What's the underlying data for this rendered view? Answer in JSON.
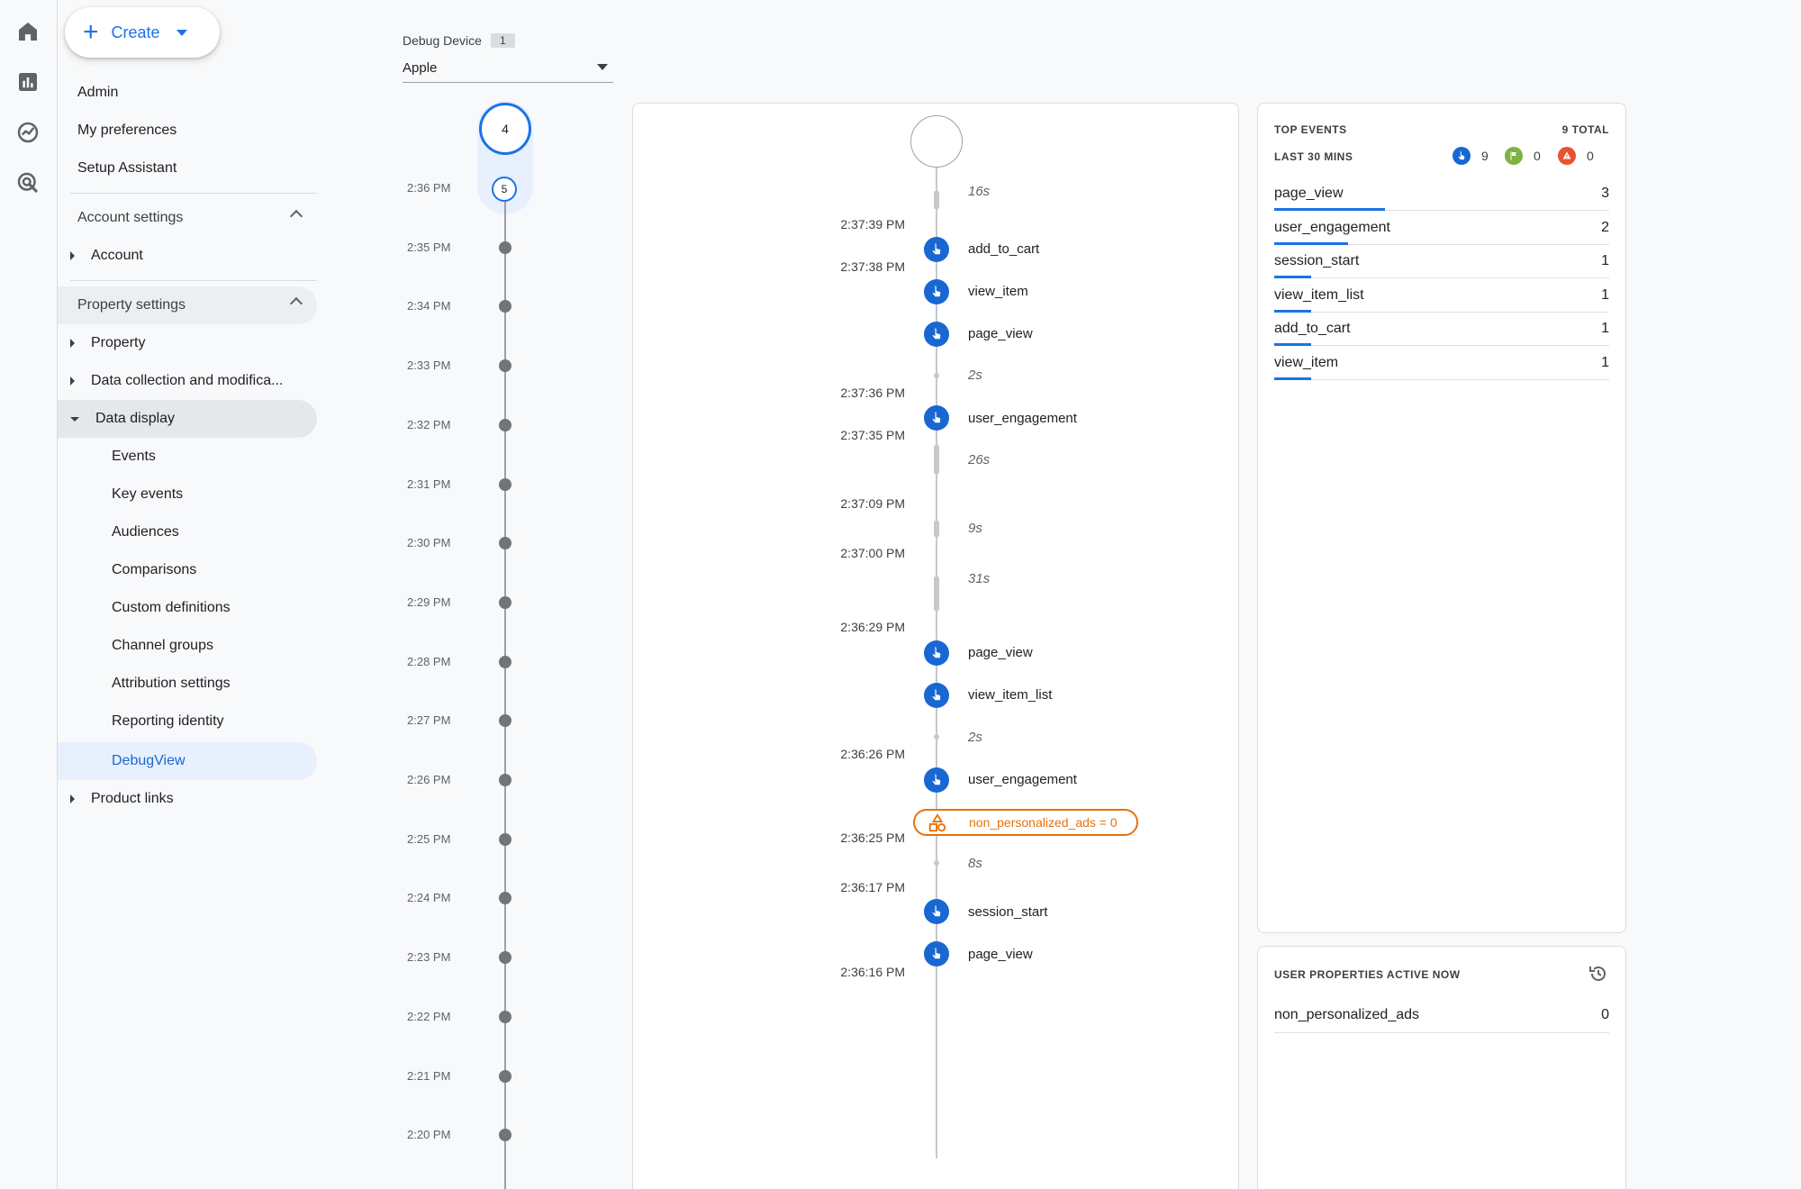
{
  "nav": {
    "create_label": "Create",
    "admin": "Admin",
    "my_preferences": "My preferences",
    "setup_assistant": "Setup Assistant",
    "account_settings": "Account settings",
    "account": "Account",
    "property_settings": "Property settings",
    "property": "Property",
    "data_collection": "Data collection and modifica...",
    "data_display": "Data display",
    "data_display_items": [
      "Events",
      "Key events",
      "Audiences",
      "Comparisons",
      "Custom definitions",
      "Channel groups",
      "Attribution settings",
      "Reporting identity",
      "DebugView"
    ],
    "product_links": "Product links"
  },
  "device": {
    "label": "Debug Device",
    "count": "1",
    "selected": "Apple"
  },
  "minutes": {
    "current_count": "4",
    "selected_count": "5",
    "labels": [
      "2:36 PM",
      "2:35 PM",
      "2:34 PM",
      "2:33 PM",
      "2:32 PM",
      "2:31 PM",
      "2:30 PM",
      "2:29 PM",
      "2:28 PM",
      "2:27 PM",
      "2:26 PM",
      "2:25 PM",
      "2:24 PM",
      "2:23 PM",
      "2:22 PM",
      "2:21 PM",
      "2:20 PM"
    ]
  },
  "seconds": {
    "gaps": [
      "16s",
      "2s",
      "26s",
      "9s",
      "31s",
      "2s",
      "8s"
    ],
    "timestamps": [
      "2:37:39 PM",
      "2:37:38 PM",
      "2:37:36 PM",
      "2:37:35 PM",
      "2:37:09 PM",
      "2:37:00 PM",
      "2:36:29 PM",
      "2:36:26 PM",
      "2:36:25 PM",
      "2:36:17 PM",
      "2:36:16 PM"
    ],
    "events": [
      "add_to_cart",
      "view_item",
      "page_view",
      "user_engagement",
      "page_view",
      "view_item_list",
      "user_engagement",
      "session_start",
      "page_view"
    ],
    "property_change": "non_personalized_ads = 0"
  },
  "top_events": {
    "title": "TOP EVENTS",
    "total": "9 TOTAL",
    "subtitle": "LAST 30 MINS",
    "counts": {
      "events": "9",
      "key_events": "0",
      "errors": "0"
    },
    "rows": [
      {
        "name": "page_view",
        "value": "3",
        "share": 1.0
      },
      {
        "name": "user_engagement",
        "value": "2",
        "share": 0.67
      },
      {
        "name": "session_start",
        "value": "1",
        "share": 0.33
      },
      {
        "name": "view_item_list",
        "value": "1",
        "share": 0.33
      },
      {
        "name": "add_to_cart",
        "value": "1",
        "share": 0.33
      },
      {
        "name": "view_item",
        "value": "1",
        "share": 0.33
      }
    ],
    "colors": {
      "event": "#1967d2",
      "key_event": "#7cb342",
      "error": "#e8522e"
    }
  },
  "user_properties": {
    "title": "USER PROPERTIES ACTIVE NOW",
    "rows": [
      {
        "name": "non_personalized_ads",
        "value": "0"
      }
    ]
  }
}
